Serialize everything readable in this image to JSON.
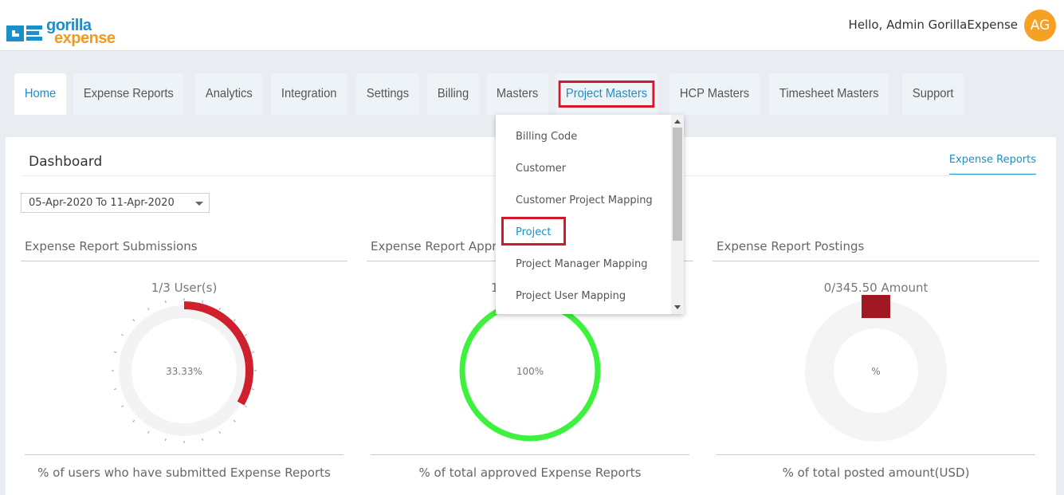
{
  "header": {
    "logo_top": "gorilla",
    "logo_bottom": "expense",
    "greeting": "Hello, Admin GorillaExpense",
    "avatar_initials": "AG"
  },
  "nav": {
    "tabs": [
      {
        "label": "Home",
        "state": "active"
      },
      {
        "label": "Expense Reports",
        "state": ""
      },
      {
        "label": "Analytics",
        "state": ""
      },
      {
        "label": "Integration",
        "state": ""
      },
      {
        "label": "Settings",
        "state": ""
      },
      {
        "label": "Billing",
        "state": ""
      },
      {
        "label": "Masters",
        "state": ""
      },
      {
        "label": "Project Masters",
        "state": "highlight"
      },
      {
        "label": "HCP Masters",
        "state": ""
      },
      {
        "label": "Timesheet Masters",
        "state": ""
      },
      {
        "label": "Support",
        "state": ""
      }
    ]
  },
  "dropdown": {
    "items": [
      "Billing Code",
      "Customer",
      "Customer Project Mapping",
      "Project",
      "Project Manager Mapping",
      "Project User Mapping"
    ],
    "selected_index": 3
  },
  "dashboard": {
    "title": "Dashboard",
    "link": "Expense Reports",
    "date_range": "05-Apr-2020 To 11-Apr-2020",
    "panels": [
      {
        "title": "Expense Report Submissions",
        "subtitle": "1/3 User(s)",
        "center": "33.33%",
        "fraction": 0.3333,
        "color": "#d0202e",
        "footer": "% of users who have submitted Expense Reports"
      },
      {
        "title": "Expense Report Approvals",
        "subtitle": "1/1 Report(s)",
        "center": "100%",
        "fraction": 1.0,
        "color": "#3cf23c",
        "footer": "% of total approved Expense Reports"
      },
      {
        "title": "Expense Report Postings",
        "subtitle": "0/345.50 Amount",
        "center": "%",
        "fraction": 0,
        "color": "#a01822",
        "footer": "% of total posted amount(USD)"
      }
    ]
  },
  "colors": {
    "accent": "#1b8fc9",
    "highlight_box": "#d3182b",
    "avatar": "#f5a123"
  }
}
